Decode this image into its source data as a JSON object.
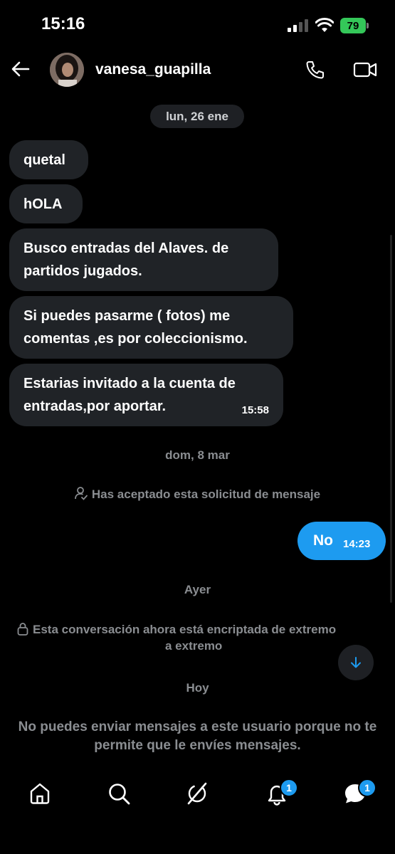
{
  "status_bar": {
    "time": "15:16",
    "battery": "79"
  },
  "header": {
    "username": "vanesa_guapilla"
  },
  "date_chip": "lun, 26 ene",
  "messages_incoming": [
    {
      "text": "quetal"
    },
    {
      "text": "hOLA"
    },
    {
      "text": "Busco entradas del Alaves.  de partidos jugados."
    },
    {
      "text": "Si puedes pasarme ( fotos) me comentas ,es por coleccionismo."
    },
    {
      "text": "Estarias invitado a la cuenta de entradas,por aportar.",
      "time": "15:58"
    }
  ],
  "date_separator_2": "dom, 8 mar",
  "accepted_notice": "Has aceptado esta solicitud de mensaje",
  "message_outgoing": {
    "text": "No",
    "time": "14:23"
  },
  "date_separator_3": "Ayer",
  "encryption_notice": {
    "line1": "Esta conversación ahora está encriptada de extremo",
    "line2": "a extremo"
  },
  "date_separator_4": "Hoy",
  "cannot_send_notice": "No puedes enviar mensajes a este usuario porque no te permite que le envíes mensajes.",
  "bottom_nav": {
    "items": [
      {
        "icon": "home-icon"
      },
      {
        "icon": "search-icon"
      },
      {
        "icon": "grok-icon"
      },
      {
        "icon": "bell-icon",
        "badge": "1"
      },
      {
        "icon": "messages-icon",
        "badge": "1"
      }
    ]
  },
  "colors": {
    "accent": "#1d9bf0",
    "bubble_in": "#202327",
    "muted_text": "#8a8d91",
    "battery": "#34c759"
  }
}
